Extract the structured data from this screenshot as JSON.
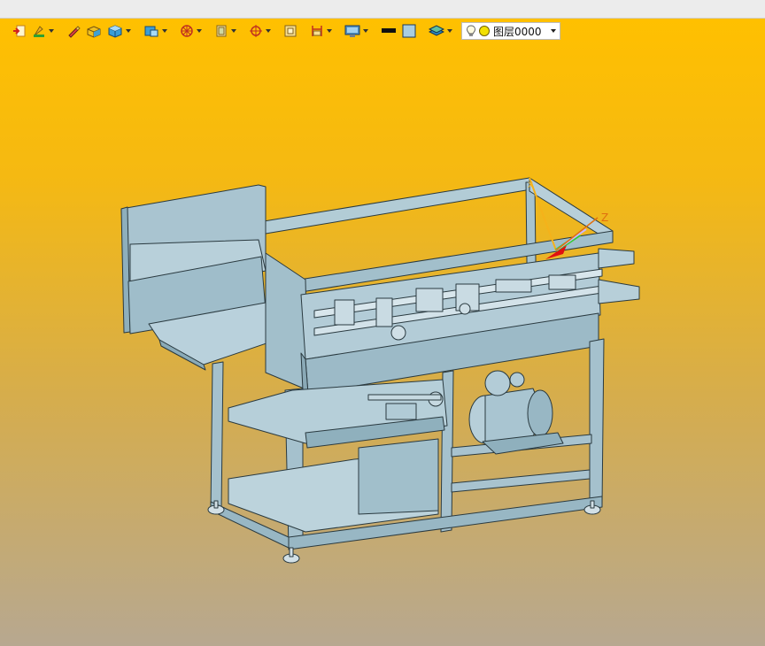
{
  "toolbar": {
    "buttons": [
      {
        "name": "import-icon",
        "has_dropdown": false
      },
      {
        "name": "sketch-tools-icon",
        "has_dropdown": true
      },
      {
        "name": "pen-icon",
        "has_dropdown": false
      },
      {
        "name": "extrude-solid-icon",
        "has_dropdown": false
      },
      {
        "name": "box-solid-icon",
        "has_dropdown": true
      },
      {
        "name": "shell-solid-icon",
        "has_dropdown": true
      },
      {
        "name": "wheel-icon",
        "has_dropdown": true
      },
      {
        "name": "view-cube-icon",
        "has_dropdown": true
      },
      {
        "name": "locator-icon",
        "has_dropdown": true
      },
      {
        "name": "frame-icon",
        "has_dropdown": false
      },
      {
        "name": "dimension-icon",
        "has_dropdown": true
      },
      {
        "name": "display-mode-icon",
        "has_dropdown": true
      },
      {
        "name": "line-color-swatch",
        "has_dropdown": false
      },
      {
        "name": "face-color-swatch",
        "has_dropdown": false
      },
      {
        "name": "layer-manager-icon",
        "has_dropdown": true
      }
    ],
    "layer_select": {
      "value": "图层0000"
    }
  },
  "colors": {
    "bg_top": "#ffc000",
    "bg_bottom": "#b7a890",
    "model_fill": "#a7c3cf",
    "model_edge": "#2a3a40",
    "line_swatch": "#111111",
    "face_swatch": "#a9cde0"
  },
  "axis": {
    "z_label": "Z",
    "x_label": "X"
  }
}
